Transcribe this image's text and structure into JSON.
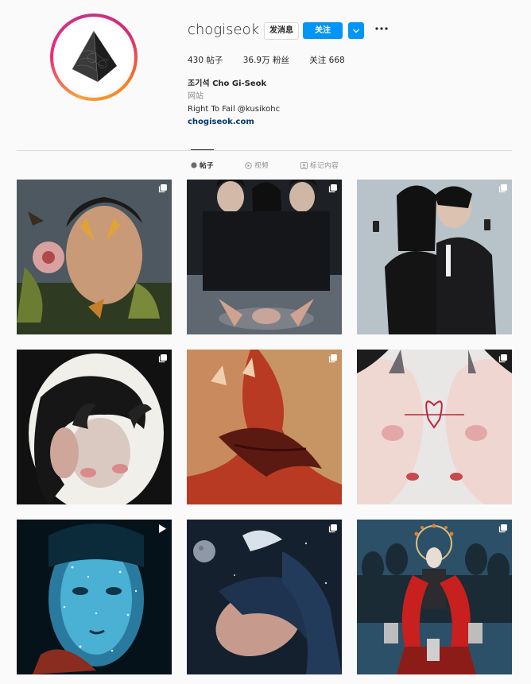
{
  "profile": {
    "username": "chogiseok",
    "message_button": "发消息",
    "follow_button": "关注",
    "dropdown_icon": "chevron-down-icon",
    "more_icon": "more-options-icon",
    "stats": {
      "posts": "430 帖子",
      "followers": "36.9万 粉丝",
      "following": "关注 668"
    },
    "bio": {
      "full_name": "조기석 Cho Gi-Seok",
      "category": "网站",
      "text": "Right To Fail @kusikohc",
      "link": "chogiseok.com"
    }
  },
  "tabs": [
    {
      "label": "帖子",
      "icon": "grid-icon",
      "active": true
    },
    {
      "label": "视频",
      "icon": "video-icon",
      "active": false
    },
    {
      "label": "标记内容",
      "icon": "tagged-icon",
      "active": false
    }
  ],
  "posts": [
    {
      "badge": "carousel-icon"
    },
    {
      "badge": "carousel-icon"
    },
    {
      "badge": "carousel-icon"
    },
    {
      "badge": "carousel-icon"
    },
    {
      "badge": "carousel-icon"
    },
    {
      "badge": "carousel-icon"
    },
    {
      "badge": "video-icon"
    },
    {
      "badge": "carousel-icon"
    },
    {
      "badge": "carousel-icon"
    }
  ],
  "colors": {
    "accent": "#0095f6",
    "text": "#262626",
    "muted": "#8e8e8e",
    "link": "#00376b",
    "background": "#fafafa"
  }
}
